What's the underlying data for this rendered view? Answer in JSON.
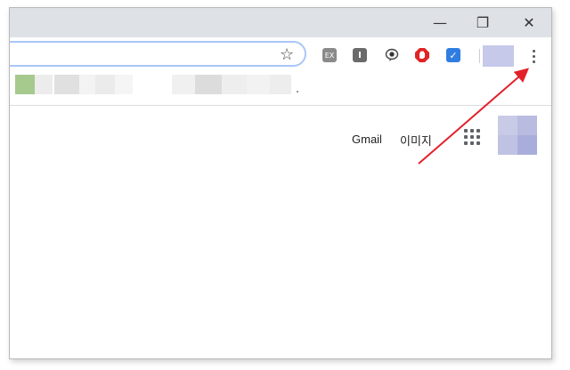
{
  "window_controls": {
    "minimize": "—",
    "restore": "❐",
    "close": "✕"
  },
  "toolbar": {
    "bookmark_star": "☆",
    "extensions": [
      {
        "name": "ex-extension",
        "label": "EX",
        "color": "#7f7f7f"
      },
      {
        "name": "reader-extension",
        "label": "I",
        "color": "#6b6b6b"
      },
      {
        "name": "speech-extension",
        "label": "",
        "color": "#3d3d3d"
      },
      {
        "name": "adblock-extension",
        "label": "",
        "color": "#e02424"
      },
      {
        "name": "checkmark-extension",
        "label": "✓",
        "color": "#1a73e8"
      }
    ],
    "menu_icon": "customize-and-control-menu"
  },
  "content": {
    "gmail": "Gmail",
    "images": "이미지"
  },
  "colors": {
    "titlebar": "#dee1e6",
    "omnibox_focus": "#a8c7fa",
    "annotation_arrow": "#e3202a",
    "avatar_tile": "#c6c9ea"
  }
}
